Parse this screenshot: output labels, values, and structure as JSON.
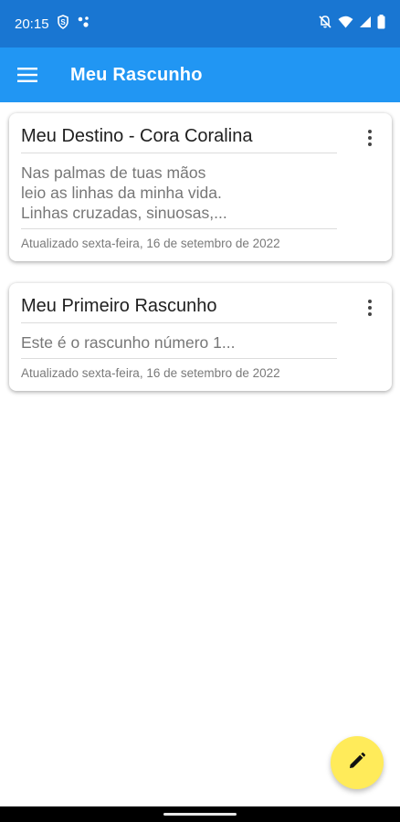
{
  "status_bar": {
    "time": "20:15",
    "icons_left": [
      "s-badge-icon",
      "assistant-dots-icon"
    ],
    "icons_right": [
      "bell-off-icon",
      "wifi-icon",
      "signal-icon",
      "battery-icon"
    ]
  },
  "app_bar": {
    "title": "Meu Rascunho",
    "menu_icon": "hamburger-menu-icon",
    "color": "#2196f3",
    "status_color": "#1976d2"
  },
  "drafts": [
    {
      "title": "Meu Destino - Cora Coralina",
      "body": "Nas palmas de tuas mãos\nleio as linhas da minha vida.\nLinhas cruzadas, sinuosas,...",
      "updated": "Atualizado sexta-feira, 16 de setembro de 2022"
    },
    {
      "title": "Meu Primeiro Rascunho",
      "body": "Este é o rascunho número 1...",
      "updated": "Atualizado sexta-feira, 16 de setembro de 2022"
    }
  ],
  "fab": {
    "icon": "pencil-icon",
    "color": "#ffeb5a"
  }
}
